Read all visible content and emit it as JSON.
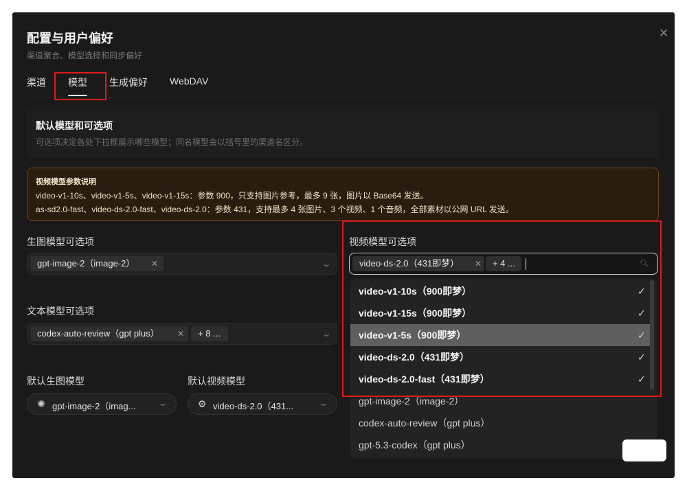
{
  "dialog": {
    "title": "配置与用户偏好",
    "subtitle": "渠道聚合、模型选择和同步偏好",
    "close_label": "×"
  },
  "tabs": [
    {
      "label": "渠道",
      "active": false
    },
    {
      "label": "模型",
      "active": true
    },
    {
      "label": "生成偏好",
      "active": false
    },
    {
      "label": "WebDAV",
      "active": false
    }
  ],
  "card": {
    "title": "默认模型和可选项",
    "description": "可选项决定各处下拉框展示哪些模型；同名模型会以括号里的渠道名区分。"
  },
  "notice": {
    "title": "视频模型参数说明",
    "line1": "video-v1-10s、video-v1-5s、video-v1-15s：参数 900，只支持图片参考，最多 9 张，图片以 Base64 发送。",
    "line2": "as-sd2.0-fast、video-ds-2.0-fast、video-ds-2.0：参数 431，支持最多 4 张图片、3 个视频、1 个音频，全部素材以公网 URL 发送。"
  },
  "image_models": {
    "label": "生图模型可选项",
    "chips": [
      "gpt-image-2（image-2）"
    ]
  },
  "text_models": {
    "label": "文本模型可选项",
    "chips": [
      "codex-auto-review（gpt plus）"
    ],
    "more": "+ 8 ..."
  },
  "default_image": {
    "label": "默认生图模型",
    "value": "gpt-image-2（imag...",
    "icon": "openai-icon"
  },
  "default_video": {
    "label": "默认视频模型",
    "value": "video-ds-2.0（431...",
    "icon": "chip-icon"
  },
  "video_models": {
    "label": "视频模型可选项",
    "chips": [
      "video-ds-2.0（431即梦）"
    ],
    "more": "+ 4 ...",
    "options": [
      {
        "label": "video-v1-10s（900即梦）",
        "selected": true
      },
      {
        "label": "video-v1-15s（900即梦）",
        "selected": true
      },
      {
        "label": "video-v1-5s（900即梦）",
        "selected": true
      },
      {
        "label": "video-ds-2.0（431即梦）",
        "selected": true
      },
      {
        "label": "video-ds-2.0-fast（431即梦）",
        "selected": true
      },
      {
        "label": "gpt-image-2（image-2）",
        "selected": false
      },
      {
        "label": "codex-auto-review（gpt plus）",
        "selected": false
      },
      {
        "label": "gpt-5.3-codex（gpt plus）",
        "selected": false
      }
    ]
  },
  "colors": {
    "background": "#1a1a1a",
    "annotation": "#e01b1b",
    "notice_bg": "#2a1d10",
    "notice_border": "#6b4418"
  }
}
